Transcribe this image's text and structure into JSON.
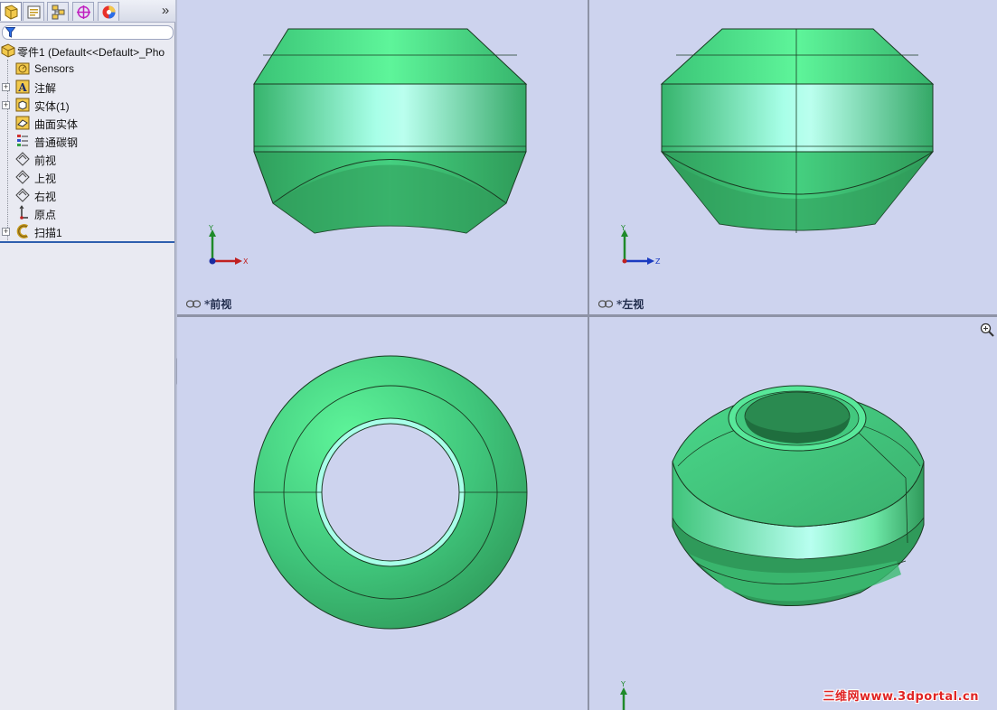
{
  "feature_manager": {
    "tabs": [
      {
        "name": "feature-manager-tab",
        "icon": "feature-tree-icon"
      },
      {
        "name": "property-manager-tab",
        "icon": "property-icon"
      },
      {
        "name": "configuration-manager-tab",
        "icon": "configuration-icon"
      },
      {
        "name": "dimxpert-manager-tab",
        "icon": "target-icon"
      },
      {
        "name": "display-manager-tab",
        "icon": "appearance-icon"
      }
    ],
    "more_label": "»",
    "tree": {
      "root_label": "零件1  (Default<<Default>_Pho",
      "items": [
        {
          "label": "Sensors",
          "icon": "sensor-icon",
          "expandable": false
        },
        {
          "label": "注解",
          "icon": "annotations-icon",
          "expandable": true
        },
        {
          "label": "实体(1)",
          "icon": "solid-bodies-icon",
          "expandable": true
        },
        {
          "label": "曲面实体",
          "icon": "surface-bodies-icon",
          "expandable": false
        },
        {
          "label": "普通碳钢",
          "icon": "material-icon",
          "expandable": false
        },
        {
          "label": "前视",
          "icon": "plane-icon",
          "expandable": false
        },
        {
          "label": "上视",
          "icon": "plane-icon",
          "expandable": false
        },
        {
          "label": "右视",
          "icon": "plane-icon",
          "expandable": false
        },
        {
          "label": "原点",
          "icon": "origin-icon",
          "expandable": false
        },
        {
          "label": "扫描1",
          "icon": "sweep-icon",
          "expandable": true
        }
      ]
    }
  },
  "viewports": {
    "front": {
      "label": "*前视",
      "triad": [
        "Y",
        "X"
      ]
    },
    "left": {
      "label": "*左视",
      "triad": [
        "Y",
        "Z"
      ]
    },
    "bottom_left_triad": "",
    "iso_triad": "Y"
  },
  "colors": {
    "background": "#cdd3ee",
    "model_base": "#3fc47a",
    "model_highlight": "#b8fff0",
    "model_shadow": "#2a8a52",
    "edge": "#1a3a22"
  },
  "watermark": "三维网www.3dportal.cn"
}
